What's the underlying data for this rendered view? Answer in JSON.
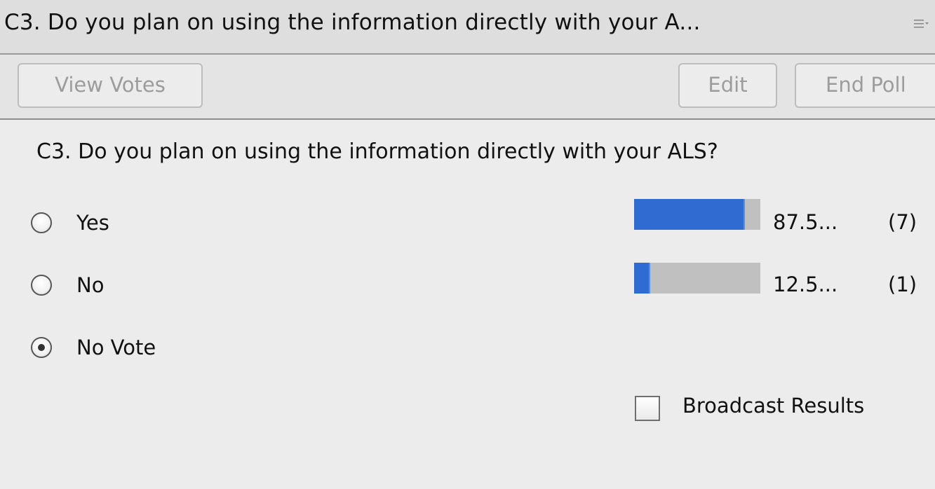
{
  "header": {
    "title": "C3. Do you plan on using the information directly with your  A...",
    "menu_icon": "hamburger-menu-icon"
  },
  "toolbar": {
    "view_votes_label": "View Votes",
    "edit_label": "Edit",
    "end_poll_label": "End Poll"
  },
  "poll": {
    "question": "C3. Do you plan on using the information directly with your  ALS?",
    "options": [
      {
        "label": "Yes",
        "selected": false,
        "percent_label": "87.5...",
        "fraction": 0.875,
        "count": "(7)"
      },
      {
        "label": "No",
        "selected": false,
        "percent_label": "12.5...",
        "fraction": 0.125,
        "count": "(1)"
      },
      {
        "label": "No Vote",
        "selected": true
      }
    ]
  },
  "broadcast": {
    "label": "Broadcast Results",
    "checked": false
  },
  "colors": {
    "bar_fill": "#2f6bd0",
    "bar_track": "#c0c0c0",
    "background": "#ececec"
  }
}
